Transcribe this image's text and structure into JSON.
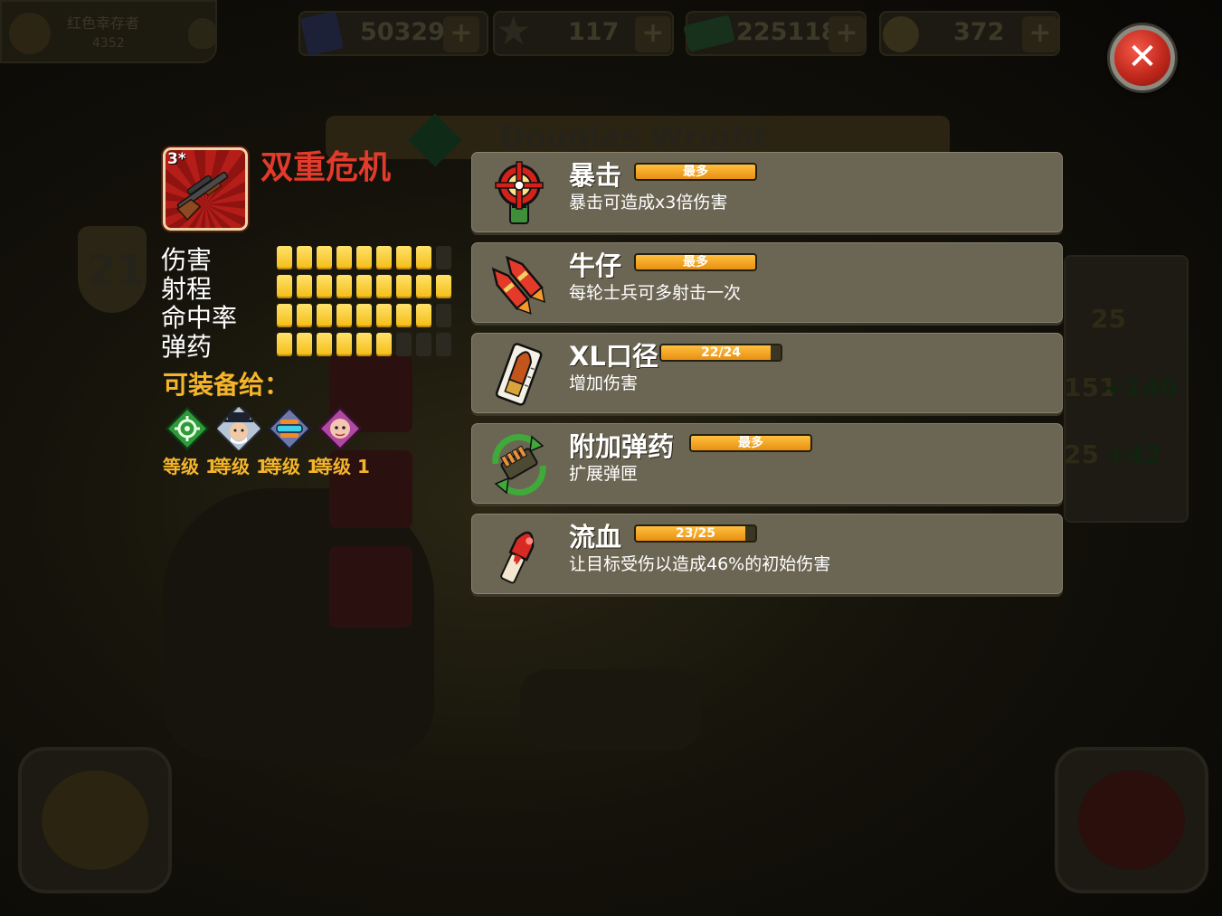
{
  "topbar": {
    "player_name": "红色幸存者",
    "player_xp": "4352",
    "resources": [
      {
        "icon": "book-icon",
        "value": "50329"
      },
      {
        "icon": "star-icon",
        "value": "117"
      },
      {
        "icon": "cash-icon",
        "value": "2251184"
      },
      {
        "icon": "coin-icon",
        "value": "372"
      }
    ],
    "plus_label": "+"
  },
  "background": {
    "character_name": "Douglas Wright",
    "level_badge": "21",
    "stat_values": [
      "25",
      "151",
      "+140",
      "25",
      "+42"
    ]
  },
  "close_label": "✕",
  "weapon": {
    "stars": "3*",
    "name": "双重危机",
    "stats": [
      {
        "label": "伤害",
        "value": 8,
        "max": 9
      },
      {
        "label": "射程",
        "value": 9,
        "max": 9
      },
      {
        "label": "命中率",
        "value": 8,
        "max": 9
      },
      {
        "label": "弹药",
        "value": 6,
        "max": 9
      }
    ]
  },
  "equip": {
    "title": "可装备给：",
    "items": [
      {
        "icon": "target-icon",
        "level": "等级 1"
      },
      {
        "icon": "commander-avatar-icon",
        "level": "等级 1"
      },
      {
        "icon": "drone-icon",
        "level": "等级 1"
      },
      {
        "icon": "pink-soldier-avatar-icon",
        "level": "等级 1"
      }
    ]
  },
  "upgrades": [
    {
      "icon": "crosshair-icon",
      "name": "暴击",
      "bar_label": "最多",
      "progress": 1.0,
      "desc": "暴击可造成x3倍伤害"
    },
    {
      "icon": "rockets-icon",
      "name": "牛仔",
      "bar_label": "最多",
      "progress": 1.0,
      "desc": "每轮士兵可多射击一次"
    },
    {
      "icon": "bullet-icon",
      "name": "XL口径",
      "bar_label": "22/24",
      "progress": 0.917,
      "desc": "增加伤害"
    },
    {
      "icon": "ammo-belt-icon",
      "name": "附加弹药",
      "bar_label": "最多",
      "progress": 1.0,
      "desc": "扩展弹匣"
    },
    {
      "icon": "blood-vial-icon",
      "name": "流血",
      "bar_label": "23/25",
      "progress": 0.92,
      "desc": "让目标受伤以造成46%的初始伤害"
    }
  ],
  "colors": {
    "accent_gold": "#f5b52a",
    "weapon_name_red": "#e23b2b",
    "card_bg": "#6b6553",
    "bar_fill": "#f0a020"
  }
}
